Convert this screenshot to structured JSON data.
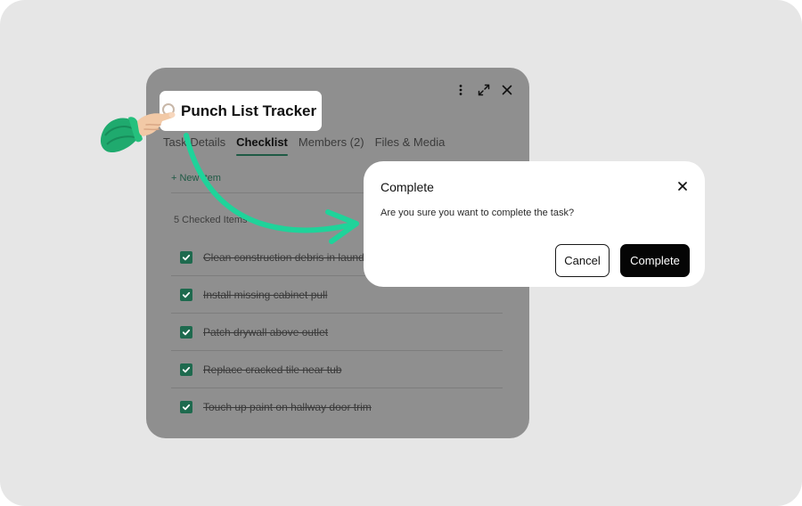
{
  "task": {
    "title": "Punch List Tracker"
  },
  "tabs": [
    {
      "label": "Task Details",
      "active": false
    },
    {
      "label": "Checklist",
      "active": true
    },
    {
      "label": "Members (2)",
      "active": false
    },
    {
      "label": "Files & Media",
      "active": false
    }
  ],
  "checklist": {
    "new_item_label": "+ New Item",
    "checked_count_label": "5 Checked Items",
    "items": [
      {
        "text": "Clean construction debris in laundry",
        "checked": true
      },
      {
        "text": "Install missing cabinet pull",
        "checked": true
      },
      {
        "text": "Patch drywall above outlet",
        "checked": true
      },
      {
        "text": "Replace cracked tile near tub",
        "checked": true
      },
      {
        "text": "Touch up paint on hallway door trim",
        "checked": true
      }
    ]
  },
  "toolbar": {
    "icons": [
      "more-vertical-icon",
      "expand-icon",
      "close-icon"
    ]
  },
  "dialog": {
    "title": "Complete",
    "message": "Are you sure you want to complete the task?",
    "cancel_label": "Cancel",
    "confirm_label": "Complete"
  },
  "colors": {
    "accent_green": "#1e6a4e",
    "arrow_teal": "#1fd39a",
    "primary_button": "#050505"
  }
}
